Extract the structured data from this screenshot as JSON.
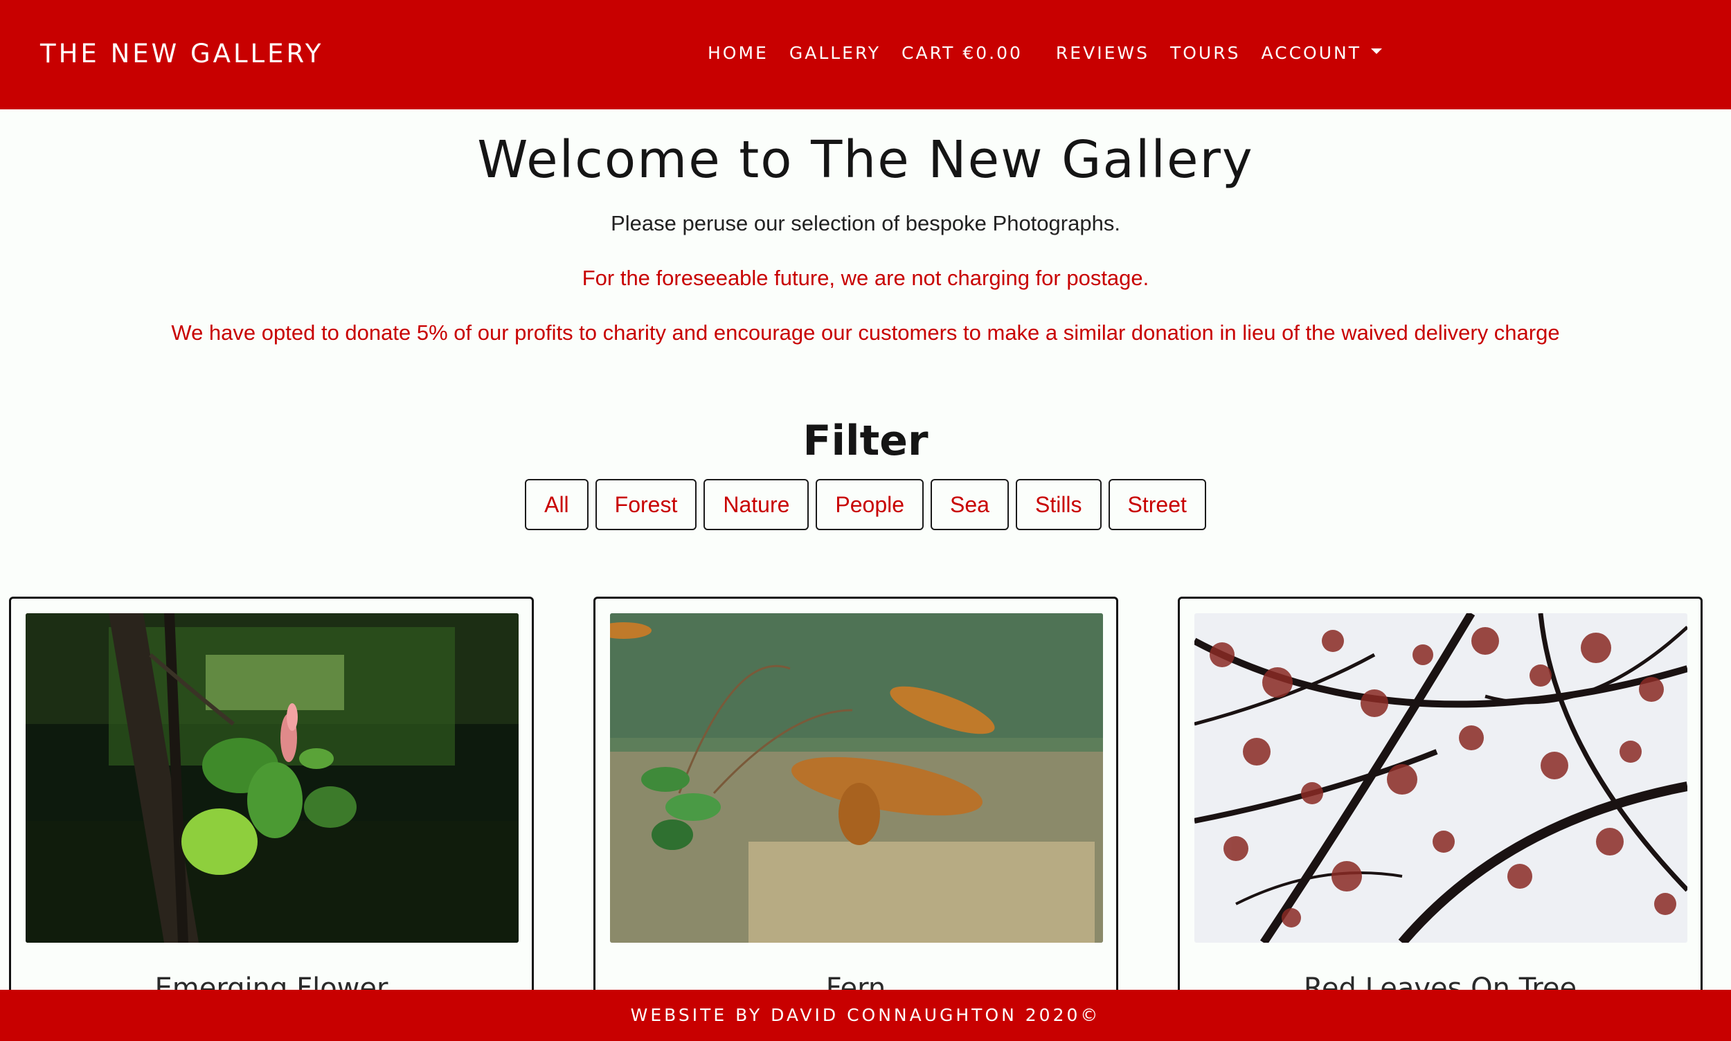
{
  "navbar": {
    "brand": "THE NEW GALLERY",
    "links": [
      "HOME",
      "GALLERY",
      "CART €0.00",
      "REVIEWS",
      "TOURS",
      "ACCOUNT"
    ],
    "bg_color": "#c80000"
  },
  "intro": {
    "heading": "Welcome to The New Gallery",
    "line1": "Please peruse our selection of bespoke Photographs.",
    "line2": "For the foreseeable future, we are not charging for postage.",
    "line3": "We have opted to donate 5% of our profits to charity and encourage our customers to make a similar donation in lieu of the waived delivery charge"
  },
  "filter": {
    "title": "Filter",
    "options": [
      "All",
      "Forest",
      "Nature",
      "People",
      "Sea",
      "Stills",
      "Street"
    ]
  },
  "products": [
    {
      "title": "Emerging Flower"
    },
    {
      "title": "Fern"
    },
    {
      "title": "Red Leaves On Tree"
    }
  ],
  "footer": {
    "text": "WEBSITE BY DAVID CONNAUGHTON 2020©"
  }
}
